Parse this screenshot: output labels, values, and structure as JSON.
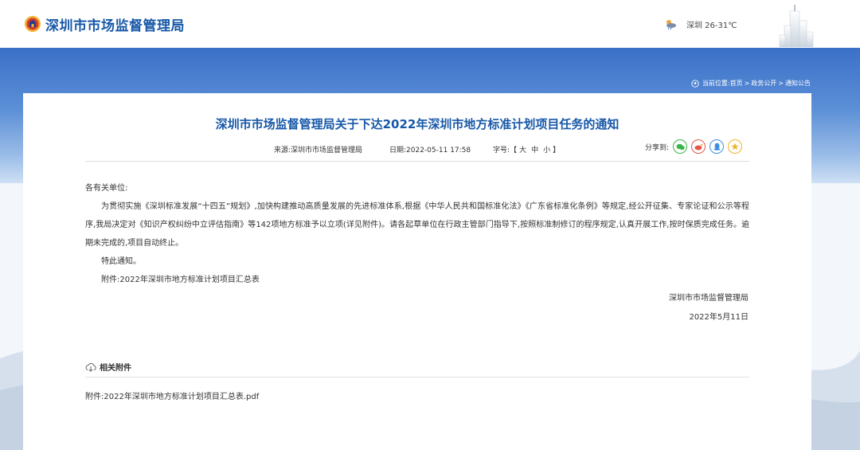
{
  "header": {
    "logo_text": "深圳市市场监督管理局",
    "weather": "深圳 26-31℃"
  },
  "breadcrumb": {
    "prefix": "当前位置:",
    "items": [
      "首页",
      "政务公开",
      "通知公告"
    ],
    "separator": ">"
  },
  "article": {
    "title": "深圳市市场监督管理局关于下达2022年深圳市地方标准计划项目任务的通知",
    "source": "来源:深圳市市场监督管理局",
    "date": "日期:2022-05-11 17:58",
    "font_size_label": "字号:【",
    "font_sizes": [
      "大",
      "中",
      "小"
    ],
    "font_size_close": "】",
    "share_label": "分享到:",
    "greeting": "各有关单位:",
    "paragraph": "为贯彻实施《深圳标准发展“十四五”规划》,加快构建推动高质量发展的先进标准体系,根据《中华人民共和国标准化法》《广东省标准化条例》等规定,经公开征集、专家论证和公示等程序,我局决定对《知识产权纠纷中立评估指南》等142项地方标准予以立项(详见附件)。请各起草单位在行政主管部门指导下,按照标准制修订的程序规定,认真开展工作,按时保质完成任务。逾期未完成的,项目自动终止。",
    "closing": "特此通知。",
    "attachment_ref": "附件:2022年深圳市地方标准计划项目汇总表",
    "signature": "深圳市市场监督管理局",
    "sign_date": "2022年5月11日"
  },
  "attachments": {
    "title": "相关附件",
    "file": "附件:2022年深圳市地方标准计划项目汇总表.pdf"
  },
  "share_icons": [
    "wechat-icon",
    "weibo-icon",
    "qq-icon",
    "qzone-icon"
  ],
  "colors": {
    "brand": "#1758a8",
    "banner": "#3b70c8"
  }
}
